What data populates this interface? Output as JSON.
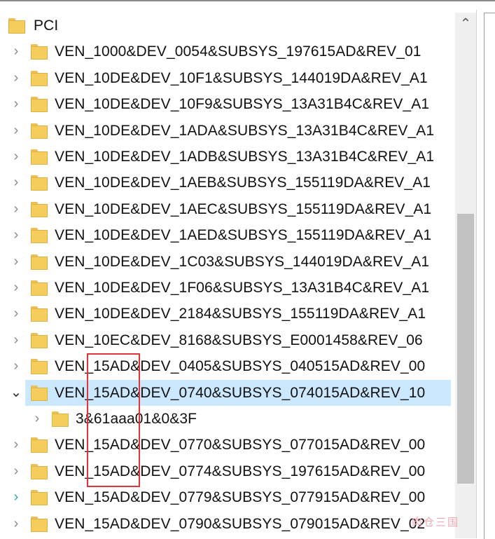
{
  "tree": {
    "root": {
      "label": "PCI",
      "icon": "folder-icon"
    },
    "rows": [
      {
        "label": "VEN_1000&DEV_0054&SUBSYS_197615AD&REV_01",
        "expander": "collapsed"
      },
      {
        "label": "VEN_10DE&DEV_10F1&SUBSYS_144019DA&REV_A1",
        "expander": "collapsed"
      },
      {
        "label": "VEN_10DE&DEV_10F9&SUBSYS_13A31B4C&REV_A1",
        "expander": "collapsed"
      },
      {
        "label": "VEN_10DE&DEV_1ADA&SUBSYS_13A31B4C&REV_A1",
        "expander": "collapsed"
      },
      {
        "label": "VEN_10DE&DEV_1ADB&SUBSYS_13A31B4C&REV_A1",
        "expander": "collapsed"
      },
      {
        "label": "VEN_10DE&DEV_1AEB&SUBSYS_155119DA&REV_A1",
        "expander": "collapsed"
      },
      {
        "label": "VEN_10DE&DEV_1AEC&SUBSYS_155119DA&REV_A1",
        "expander": "collapsed"
      },
      {
        "label": "VEN_10DE&DEV_1AED&SUBSYS_155119DA&REV_A1",
        "expander": "collapsed"
      },
      {
        "label": "VEN_10DE&DEV_1C03&SUBSYS_144019DA&REV_A1",
        "expander": "collapsed"
      },
      {
        "label": "VEN_10DE&DEV_1F06&SUBSYS_13A31B4C&REV_A1",
        "expander": "collapsed"
      },
      {
        "label": "VEN_10DE&DEV_2184&SUBSYS_155119DA&REV_A1",
        "expander": "collapsed"
      },
      {
        "label": "VEN_10EC&DEV_8168&SUBSYS_E0001458&REV_06",
        "expander": "collapsed"
      },
      {
        "label": "VEN_15AD&DEV_0405&SUBSYS_040515AD&REV_00",
        "expander": "collapsed"
      },
      {
        "label": "VEN_15AD&DEV_0740&SUBSYS_074015AD&REV_10",
        "expander": "expanded",
        "selected": true
      },
      {
        "label": "3&61aaa01&0&3F",
        "expander": "collapsed",
        "child": true
      },
      {
        "label": "VEN_15AD&DEV_0770&SUBSYS_077015AD&REV_00",
        "expander": "collapsed"
      },
      {
        "label": "VEN_15AD&DEV_0774&SUBSYS_197615AD&REV_00",
        "expander": "collapsed"
      },
      {
        "label": "VEN_15AD&DEV_0779&SUBSYS_077915AD&REV_00",
        "expander": "collapsed-hover"
      },
      {
        "label": "VEN_15AD&DEV_0790&SUBSYS_079015AD&REV_02",
        "expander": "collapsed"
      }
    ]
  },
  "scrollbar": {
    "up_arrow": "chevron-up-icon"
  },
  "annotation": {
    "highlight_color": "#e0333a",
    "highlighted_text": "15AD"
  },
  "watermark": {
    "text": "肉仓三国"
  },
  "colors": {
    "selection": "#cce8ff",
    "folder": "#f4cd5c"
  }
}
